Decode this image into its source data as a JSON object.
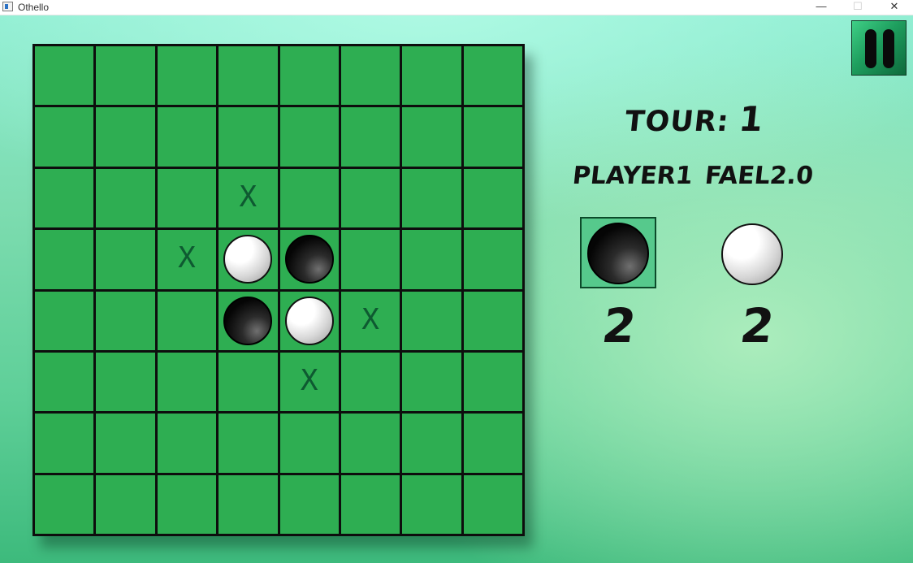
{
  "window": {
    "title": "Othello",
    "minimize_glyph": "—",
    "maximize_glyph": "☐",
    "close_glyph": "✕",
    "icon": "app-icon"
  },
  "board": {
    "size": 8,
    "colors": {
      "cell": "#2eae52",
      "grid": "#0d0d0d",
      "hint": "#0e5a31"
    },
    "hint_symbol": "X",
    "discs": [
      {
        "row": 3,
        "col": 3,
        "color": "white"
      },
      {
        "row": 3,
        "col": 4,
        "color": "black"
      },
      {
        "row": 4,
        "col": 3,
        "color": "black"
      },
      {
        "row": 4,
        "col": 4,
        "color": "white"
      }
    ],
    "hints": [
      {
        "row": 2,
        "col": 3
      },
      {
        "row": 3,
        "col": 2
      },
      {
        "row": 4,
        "col": 5
      },
      {
        "row": 5,
        "col": 4
      }
    ]
  },
  "pause_button": {
    "icon": "pause-icon"
  },
  "turn": {
    "label": "TOUR:",
    "value": "1"
  },
  "players": [
    {
      "name": "PLAYER1",
      "score": "2",
      "disc_color": "black",
      "active": true
    },
    {
      "name": "FAEL2.0",
      "score": "2",
      "disc_color": "white",
      "active": false
    }
  ]
}
